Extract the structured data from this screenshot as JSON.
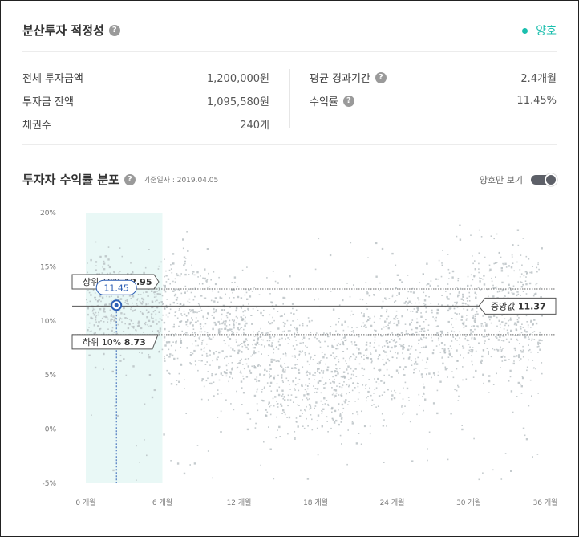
{
  "summary": {
    "title": "분산투자 적정성",
    "status_label": "양호",
    "status_color": "#1bbfae",
    "left_rows": [
      {
        "label": "전체 투자금액",
        "value": "1,200,000원"
      },
      {
        "label": "투자금 잔액",
        "value": "1,095,580원"
      },
      {
        "label": "채권수",
        "value": "240개"
      }
    ],
    "right_rows": [
      {
        "label": "평균 경과기간",
        "value": "2.4개월",
        "help": true
      },
      {
        "label": "수익률",
        "value": "11.45%",
        "help": true
      }
    ]
  },
  "distribution": {
    "title": "투자자 수익률 분포",
    "date_label": "기준일자 : 2019.04.05",
    "toggle_label": "양호만 보기"
  },
  "chart_data": {
    "type": "scatter",
    "x_tick_labels": [
      "0 개월",
      "6 개월",
      "12 개월",
      "18 개월",
      "24 개월",
      "30 개월",
      "36 개월"
    ],
    "y_tick_labels": [
      "20%",
      "15%",
      "10%",
      "5%",
      "0%",
      "-5%"
    ],
    "x_ticks": [
      0,
      6,
      12,
      18,
      24,
      30,
      36
    ],
    "y_ticks": [
      20,
      15,
      10,
      5,
      0,
      -5
    ],
    "xlim": [
      0,
      36
    ],
    "ylim": [
      -5,
      20
    ],
    "highlight_band": [
      0,
      6
    ],
    "top10": {
      "label": "상위 10%",
      "value": "12.95",
      "y": 12.95
    },
    "bottom10": {
      "label": "하위 10%",
      "value": "8.73",
      "y": 8.73
    },
    "median": {
      "label": "중앙값",
      "value": "11.37",
      "y": 11.37
    },
    "user_point": {
      "x": 2.4,
      "y": 11.45,
      "label": "11.45"
    },
    "point_color": "#b7bec2",
    "band_color": "#e9f8f6",
    "accent_color": "#2d5fb5"
  }
}
